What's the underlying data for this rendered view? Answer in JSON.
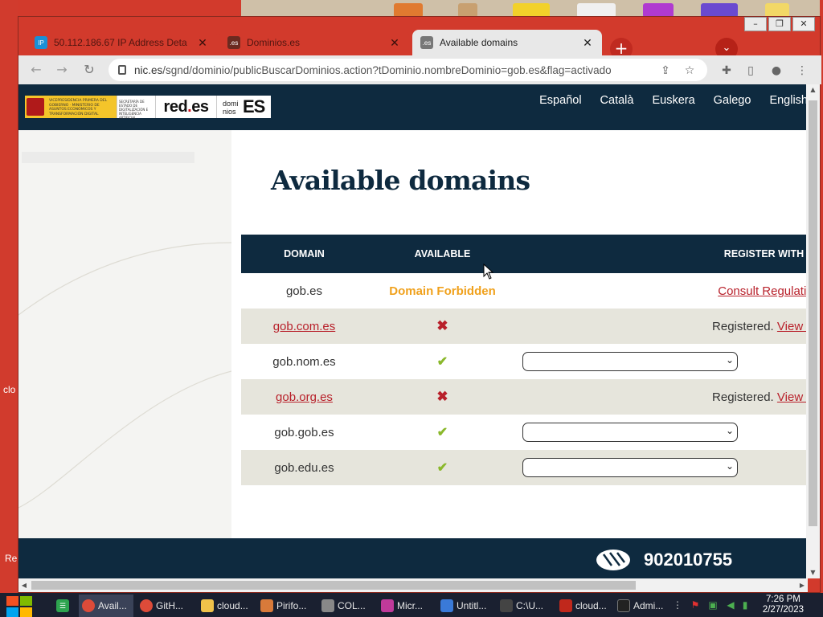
{
  "desktop": {
    "left_labels": [
      "clo",
      "Re"
    ]
  },
  "window_controls": {
    "minimize": "–",
    "restore": "❐",
    "close": "✕"
  },
  "tabs": [
    {
      "title": "50.112.186.67 IP Address Deta",
      "close": "✕",
      "favicon": "IP"
    },
    {
      "title": "Dominios.es",
      "close": "✕",
      "favicon": ".es"
    },
    {
      "title": "Available domains",
      "close": "✕",
      "favicon": ".es"
    }
  ],
  "new_tab_label": "+",
  "tab_search_label": "⌄",
  "toolbar": {
    "url_host": "nic.es",
    "url_path": "/sgnd/dominio/publicBuscarDominios.action?tDominio.nombreDominio=gob.es&flag=activado"
  },
  "site": {
    "logos": {
      "gov_text": "VICEPRESIDENCIA PRIMERA DEL GOBIERNO · MINISTERIO DE ASUNTOS ECONÓMICOS Y TRANSFORMACIÓN DIGITAL",
      "min_text": "SECRETARÍA DE ESTADO DE DIGITALIZACIÓN E INTELIGENCIA ARTIFICIAL",
      "reds_prefix": "red",
      "reds_dot": ".",
      "reds_suffix": "es",
      "domes_small_1": "domi",
      "domes_small_2": "nios",
      "domes_big": "ES"
    },
    "languages": [
      "Español",
      "Català",
      "Euskera",
      "Galego",
      "English"
    ],
    "page_title": "Available domains",
    "table": {
      "headers": {
        "domain": "DOMAIN",
        "available": "AVAILABLE",
        "register": "REGISTER WITH ..."
      },
      "rows": [
        {
          "domain": "gob.es",
          "link": false,
          "status": "Domain Forbidden",
          "register_text": "",
          "register_link": "Consult Regulation"
        },
        {
          "domain": "gob.com.es",
          "link": true,
          "status": "✖",
          "register_text": "Registered.",
          "register_link": "View do"
        },
        {
          "domain": "gob.nom.es",
          "link": false,
          "status": "✔",
          "register_select": ""
        },
        {
          "domain": "gob.org.es",
          "link": true,
          "status": "✖",
          "register_text": "Registered.",
          "register_link": "View do"
        },
        {
          "domain": "gob.gob.es",
          "link": false,
          "status": "✔",
          "register_select": ""
        },
        {
          "domain": "gob.edu.es",
          "link": false,
          "status": "✔",
          "register_select": ""
        }
      ]
    },
    "footer_phone": "902010755"
  },
  "taskbar": {
    "items": [
      "Avail...",
      "GitH...",
      "cloud...",
      "Pirifo...",
      "COL...",
      "Micr...",
      "Untitl...",
      "C:\\U...",
      "cloud...",
      "Admi..."
    ],
    "time": "7:26 PM",
    "date": "2/27/2023"
  },
  "colors": {
    "header_navy": "#0e2a3f",
    "link_red": "#b8202a",
    "forbidden_orange": "#f0a11c",
    "check_green": "#8ab82b",
    "row_alt": "#e6e5dc"
  }
}
